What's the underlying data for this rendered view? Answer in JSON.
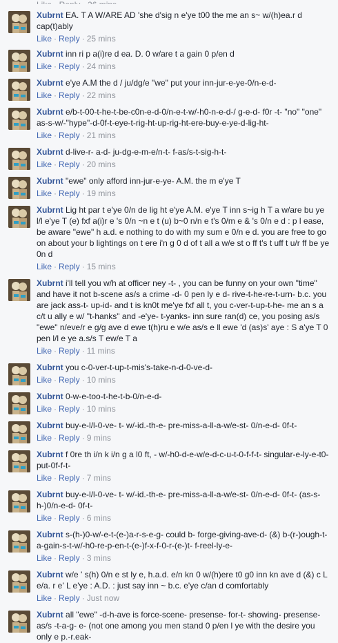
{
  "labels": {
    "like": "Like",
    "reply": "Reply",
    "separator": "·"
  },
  "comments": [
    {
      "author": "Xubrnt",
      "text": "EA. T A W/ARE AD 'she d'sig n e'ye t00 the me an s~ w/(h)ea.r d cap(t)ably",
      "time": "25 mins"
    },
    {
      "author": "Xubrnt",
      "text": "inn ri p a(i)re d ea. D. 0 w/are t a gain 0 p/en d",
      "time": "24 mins"
    },
    {
      "author": "Xubrnt",
      "text": "e'ye A.M the d / ju/dg/e \"we\" put your inn-jur-e-ye-0/n-e-d-",
      "time": "22 mins"
    },
    {
      "author": "Xubrnt",
      "text": "e/b-t-00-t-he-t-be-c0n-e-d-0/n-e-t-w/-h0-n-e-d-/ g-e-d- f0r -t- \"no\" \"one\" as-s-w/-\"hype\"-d-0f-t-eye-t-rig-ht-up-rig-ht-ere-buy-e-ye-d-lig-ht-",
      "time": "21 mins"
    },
    {
      "author": "Xubrnt",
      "text": "d-live-r- a-d- ju-dg-e-m-e/n-t- f-as/s-t-sig-h-t-",
      "time": "20 mins"
    },
    {
      "author": "Xubrnt",
      "text": "\"ewe\" only afford inn-jur-e-ye- A.M. the m e'ye T",
      "time": "19 mins"
    },
    {
      "author": "Xubrnt",
      "text": "Lig ht par t e'ye 0/n de lig ht e'ye A.M. e'ye T inn s~ig h T a w/are bu ye l/l e'ye T (e) fxf a(i)r e 's 0/n ~n e t (u) b~0 n/n e t's 0/m e & 's 0/n e d : p l ease, be aware \"ewe\" h a.d. e nothing to do with my sum e 0/n e d. you are free to go on about your b lightings on t ere i'n g 0 d of t all a w/e st o ff t's t uff t u/r ff be ye 0n d",
      "time": "15 mins"
    },
    {
      "author": "Xubrnt",
      "text": "i'll tell you w/h at officer ney -t- , you can be funny on your own \"time\" and have it not b-scene as/s a crime -d- 0 pen ly e d- rive-t-he-re-t-urn- b.c. you are jack ass-t- up-id- and t is kn0t me'ye fxf all t, you c-ver-t-up-t-he- me an s a c/t u ally e w/ \"t-hanks\" and -e'ye- t-yanks- inn sure ran(d) ce, you posing as/s \"ewe\" n/eve/r e g/g ave d ewe t(h)ru e w/e as/s e ll ewe 'd (as)s' aye : S a'ye T 0 pen l/l e ye a.s/s T ew/e T a",
      "time": "11 mins"
    },
    {
      "author": "Xubrnt",
      "text": "you c-0-ver-t-up-t-mis's-take-n-d-0-ve-d-",
      "time": "10 mins"
    },
    {
      "author": "Xubrnt",
      "text": "0-w-e-too-t-he-t-b-0/n-e-d-",
      "time": "10 mins"
    },
    {
      "author": "Xubrnt",
      "text": "buy-e-l/l-0-ve- t- w/-id.-th-e- pre-miss-a-ll-a-w/e-st- 0/n-e-d- 0f-t-",
      "time": "9 mins"
    },
    {
      "author": "Xubrnt",
      "text": "f 0re th i/n k i/n g a l0 ft, - w/-h0-d-e-w/e-d-c-u-t-0-f-f-t- singular-e-ly-e-t0-put-0f-f-t-",
      "time": "7 mins"
    },
    {
      "author": "Xubrnt",
      "text": "buy-e-l/l-0-ve- t- w/-id.-th-e- pre-miss-a-ll-a-w/e-st- 0/n-e-d- 0f-t- (as-s-h-)0/n-e-d- 0f-t-",
      "time": "6 mins"
    },
    {
      "author": "Xubrnt",
      "text": "s-(h-)0-w/-e-t-(e-)a-r-s-e-g- could b- forge-giving-ave-d- (&) b-(r-)ough-t-a-gain-s-t-w/-h0-re-p-en-t-(e-)f-x-f-0-r-(e-)t- f-reel-ly-e-",
      "time": "3 mins"
    },
    {
      "author": "Xubrnt",
      "text": "w/e ' s(h) 0/n e st ly e, h.a.d. e/n kn 0 w/(h)ere t0 g0 inn kn ave d (&) c L e/a. r e' L e'ye : A.D. : just say inn ~ b.c. e'ye c/an d comfortably",
      "time": "Just now"
    },
    {
      "author": "Xubrnt",
      "text": "all \"ewe\" -d-h-ave is force-scene- presense- for-t- showing- presense- as/s -t-a-g- e- (not one among you men stand 0 p/en l ye with the desire you only e p.-r.eak-",
      "time": ""
    }
  ]
}
